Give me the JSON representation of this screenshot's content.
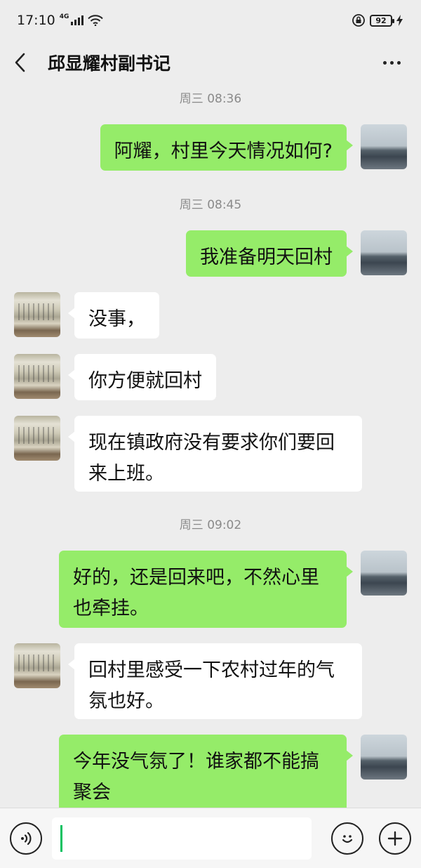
{
  "status_bar": {
    "time": "17:10",
    "network": "4G",
    "battery": "92"
  },
  "header": {
    "title": "邱显耀村副书记"
  },
  "messages": [
    {
      "type": "timestamp",
      "text": "周三 08:36"
    },
    {
      "type": "message",
      "sender": "me",
      "text": "阿耀，村里今天情况如何?"
    },
    {
      "type": "timestamp",
      "text": "周三 08:45"
    },
    {
      "type": "message",
      "sender": "me",
      "text": "我准备明天回村"
    },
    {
      "type": "message",
      "sender": "other",
      "text": "没事，"
    },
    {
      "type": "message",
      "sender": "other",
      "text": "你方便就回村"
    },
    {
      "type": "message",
      "sender": "other",
      "text": "现在镇政府没有要求你们要回来上班。"
    },
    {
      "type": "timestamp",
      "text": "周三 09:02"
    },
    {
      "type": "message",
      "sender": "me",
      "text": "好的，还是回来吧，不然心里也牵挂。"
    },
    {
      "type": "message",
      "sender": "other",
      "text": "回村里感受一下农村过年的气氛也好。"
    },
    {
      "type": "message",
      "sender": "me",
      "text": "今年没气氛了！谁家都不能搞聚会"
    }
  ],
  "input": {
    "value": ""
  },
  "colors": {
    "chat_background": "#ededed",
    "my_bubble": "#95ec69",
    "their_bubble": "#ffffff",
    "caret": "#07c160"
  }
}
